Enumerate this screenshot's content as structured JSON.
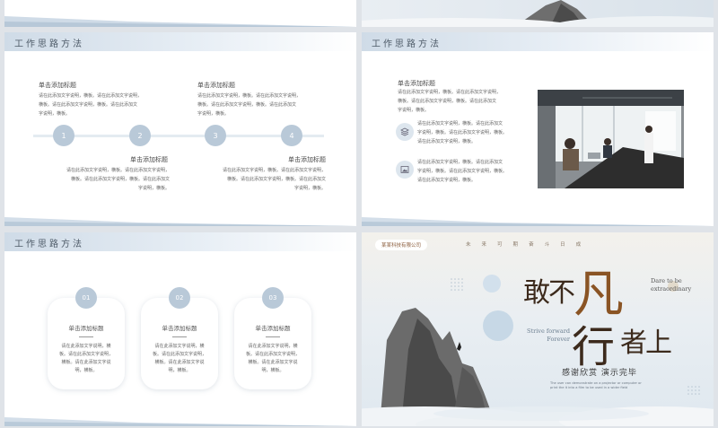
{
  "header_title": "工作思路方法",
  "slide1": {
    "title1": "单击添加标题",
    "body1": [
      "请在此添加文字说明，横板。请在此添加文字说明，",
      "横板。请在此添加文字说明，横板。请在此添加文",
      "字说明，横板。"
    ],
    "title2": "单击添加标题",
    "body2": [
      "请在此添加文字说明，横板。请在此添加文字说明，",
      "横板。请在此添加文字说明，横板。请在此添加文",
      "字说明，横板。"
    ],
    "steps": [
      "1",
      "2",
      "3",
      "4"
    ],
    "title3": "单击添加标题",
    "body3": [
      "请在此添加文字说明，横板。请在此添加文字说明，",
      "横板。请在此添加文字说明，横板。请在此添加文",
      "字说明，横板。"
    ],
    "title4": "单击添加标题",
    "body4": [
      "请在此添加文字说明，横板。请在此添加文字说明，",
      "横板。请在此添加文字说明，横板。请在此添加文",
      "字说明，横板。"
    ]
  },
  "slide2": {
    "title": "单击添加标题",
    "body": [
      "请在此添加文字说明，横板。请在此添加文字说明，",
      "横板。请在此添加文字说明，横板。请在此添加文",
      "字说明，横板。"
    ],
    "item1": [
      "请在此添加文字说明，横板。请在此添加文",
      "字说明，横板。请在此添加文字说明，横板。",
      "请在此添加文字说明，横板。"
    ],
    "item2": [
      "请在此添加文字说明，横板。请在此添加文",
      "字说明，横板。请在此添加文字说明，横板。",
      "请在此添加文字说明，横板。"
    ]
  },
  "slide3": {
    "cards": [
      {
        "num": "01",
        "title": "单击添加标题",
        "body": [
          "请在此添加文字说明，横",
          "板。请在此添加文字说明，",
          "横板。请在此添加文字说",
          "明，横板。"
        ]
      },
      {
        "num": "02",
        "title": "单击添加标题",
        "body": [
          "请在此添加文字说明，横",
          "板。请在此添加文字说明，",
          "横板。请在此添加文字说",
          "明，横板。"
        ]
      },
      {
        "num": "03",
        "title": "单击添加标题",
        "body": [
          "请在此添加文字说明，横",
          "板。请在此添加文字说明，",
          "横板。请在此添加文字说",
          "明，横板。"
        ]
      }
    ]
  },
  "slide4": {
    "company": "某某科技有限公司",
    "tagline_chars": [
      "未",
      "来",
      "可",
      "期",
      "奋",
      "斗",
      "日",
      "成"
    ],
    "main_title_1": "敢不",
    "main_title_big1": "凡",
    "main_title_big2": "行",
    "main_title_2": "者上",
    "dare": [
      "Dare to be",
      "extraordinary"
    ],
    "strive": [
      "Strive forward",
      "Forever"
    ],
    "thanks": "感谢欣赏 演示完毕",
    "small_en": [
      "The user can demonstrate on a projector or computer or",
      "print the it into a film to be used in a wider field"
    ]
  },
  "colors": {
    "accent": "#b9c9d8",
    "title_brown": "#6b4a2a",
    "header_grad": "#cfdbe7"
  }
}
